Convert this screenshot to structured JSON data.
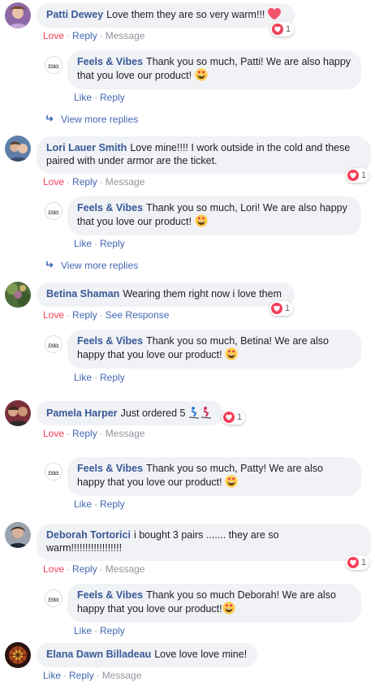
{
  "colors": {
    "name": "#385898",
    "link": "#4267b2",
    "love": "#f33e58",
    "bubble": "#f0f2f5",
    "muted": "#90949c"
  },
  "comments": [
    {
      "author": "Patti Dewey",
      "text": "Love them they are so very warm!!!",
      "actions": {
        "love": "Love",
        "reply": "Reply",
        "message": "Message"
      },
      "reaction_count": "1",
      "reply": {
        "author": "Feels & Vibes",
        "text": "Thank you so much, Patti! We are also happy that you love our product!",
        "actions": {
          "like": "Like",
          "reply": "Reply"
        }
      },
      "more_replies": "View more replies"
    },
    {
      "author": "Lori Lauer Smith",
      "text": "Love mine!!!! I work outside in the cold and these paired with under armor are the ticket.",
      "actions": {
        "love": "Love",
        "reply": "Reply",
        "message": "Message"
      },
      "reaction_count": "1",
      "reply": {
        "author": "Feels & Vibes",
        "text": "Thank you so much, Lori! We are also happy that you love our product!",
        "actions": {
          "like": "Like",
          "reply": "Reply"
        }
      },
      "more_replies": "View more replies"
    },
    {
      "author": "Betina Shaman",
      "text": "Wearing them right now i love them",
      "actions": {
        "love": "Love",
        "reply": "Reply",
        "see_response": "See Response"
      },
      "reaction_count": "1",
      "reply": {
        "author": "Feels & Vibes",
        "text": "Thank you so much, Betina! We are also happy that you love our product!",
        "actions": {
          "like": "Like",
          "reply": "Reply"
        }
      }
    },
    {
      "author": "Pamela Harper",
      "text": "Just ordered 5",
      "actions": {
        "love": "Love",
        "reply": "Reply",
        "message": "Message"
      },
      "reaction_count": "1",
      "reply": {
        "author": "Feels & Vibes",
        "text": "Thank you so much, Patty! We are also happy that you love our product!",
        "actions": {
          "like": "Like",
          "reply": "Reply"
        }
      }
    },
    {
      "author": "Deborah Tortorici",
      "text": "i bought 3 pairs ....... they are so warm!!!!!!!!!!!!!!!!!!",
      "actions": {
        "love": "Love",
        "reply": "Reply",
        "message": "Message"
      },
      "reaction_count": "1",
      "reply": {
        "author": "Feels & Vibes",
        "text": "Thank you so much Deborah! We are also happy that you love our product!",
        "actions": {
          "like": "Like",
          "reply": "Reply"
        }
      }
    },
    {
      "author": "Elana Dawn Billadeau",
      "text": "Love love love mine!",
      "actions": {
        "like": "Like",
        "reply": "Reply",
        "message": "Message"
      }
    }
  ],
  "icons": {
    "heart_emoji": "heart-emoji-icon",
    "heart_eyes": "heart-eyes-emoji-icon",
    "skier": "skier-emoji-icon",
    "reaction": "love-reaction-icon",
    "reply_arrow": "reply-arrow-icon"
  }
}
